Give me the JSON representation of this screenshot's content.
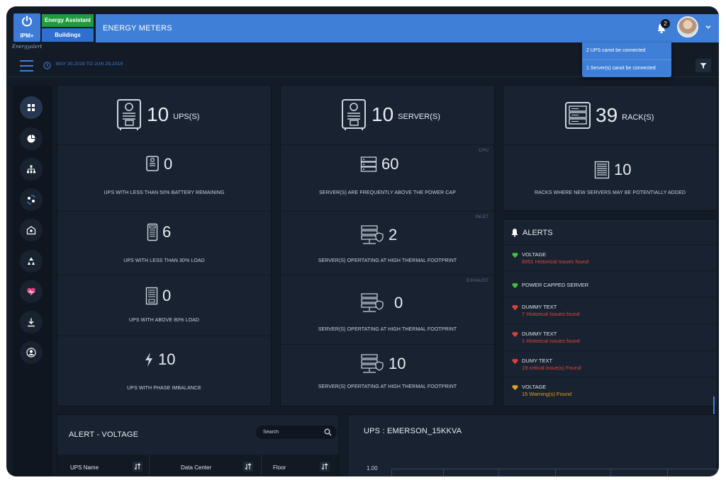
{
  "app": {
    "logo_text": "IPM+",
    "logo_script": "Energyalert",
    "energy_assistant_label": "Energy Assistant",
    "buildings_label": "Buildings",
    "section_title": "ENERGY METERS",
    "notification_count": "2",
    "accent_color": "#3f7fd8"
  },
  "notifications": [
    "2 UPS canot be connected",
    "1 Server(s) canot be connected"
  ],
  "subbar": {
    "date_range": "MAY 30,2019 TO JUN 29,2019"
  },
  "sidebar": {
    "items": [
      {
        "icon": "dashboard-icon",
        "active": true
      },
      {
        "icon": "pie-chart-icon"
      },
      {
        "icon": "hierarchy-icon"
      },
      {
        "icon": "sync-users-icon"
      },
      {
        "icon": "reports-icon"
      },
      {
        "icon": "recycle-icon"
      },
      {
        "icon": "health-icon"
      },
      {
        "icon": "download-icon"
      },
      {
        "icon": "user-icon"
      }
    ]
  },
  "ups_panel": {
    "header": {
      "count": "10",
      "unit": "UPS(S)",
      "icon": "ups-icon"
    },
    "rows": [
      {
        "value": "0",
        "caption": "UPS WITH LESS THAN 50% BATTERY REMAINING",
        "icon": "battery-ups-icon"
      },
      {
        "value": "6",
        "caption": "UPS WITH LESS THAN 30% LOAD",
        "icon": "ups-unit-icon"
      },
      {
        "value": "0",
        "caption": "UPS WITH ABOVE 80% LOAD",
        "icon": "ups-tower-icon"
      },
      {
        "value": "10",
        "caption": "UPS WITH PHASE IMBALANCE",
        "icon": "bolt-icon"
      }
    ]
  },
  "server_panel": {
    "header": {
      "count": "10",
      "unit": "SERVER(S)",
      "icon": "server-ups-icon"
    },
    "rows": [
      {
        "tag": "CPU",
        "value": "60",
        "caption": "SERVER(S) ARE FREQUENTLY ABOVE THE POWER CAP",
        "icon": "server-rack-icon"
      },
      {
        "tag": "INLET",
        "value": "2",
        "caption": "SERVER(S) OPERTATING AT HIGH  THERMAL FOOTPRINT",
        "icon": "server-shield-icon"
      },
      {
        "tag": "EXHAUST",
        "value": "0",
        "caption": "SERVER(S) OPERTATING AT HIGH  THERMAL FOOTPRINT",
        "icon": "server-shield-icon"
      },
      {
        "tag": "",
        "value": "10",
        "caption": "SERVER(S) OPERTATING AT HIGH THERMAL FOOTPRINT",
        "icon": "server-shield-icon"
      }
    ]
  },
  "rack_panel": {
    "header": {
      "count": "39",
      "unit": "RACK(S)",
      "icon": "rack-icon"
    },
    "row": {
      "value": "10",
      "caption": "RACKS WHERE NEW SERVERS MAY BE POTENTIALLY ADDED",
      "icon": "rack-cabinet-icon"
    }
  },
  "alerts": {
    "title": "ALERTS",
    "items": [
      {
        "title": "VOLTAGE",
        "sub": "6051 Historical Issues found",
        "level": "ok",
        "color": "#3fbf3f",
        "subcolor": "#e2463f"
      },
      {
        "title": "POWER CAPPED SERVER",
        "sub": "",
        "level": "ok",
        "color": "#3fbf3f",
        "subcolor": "#e2463f"
      },
      {
        "title": "DUMMY TEXT",
        "sub": "7 Historical Issues found",
        "level": "critical",
        "color": "#d9413a",
        "subcolor": "#e2463f"
      },
      {
        "title": "DUMMY TEXT",
        "sub": "1 Historical Issues found",
        "level": "critical",
        "color": "#d9413a",
        "subcolor": "#e2463f"
      },
      {
        "title": "DUMY TEXT",
        "sub": "19 critical issue(s) Found",
        "level": "critical",
        "color": "#d9413a",
        "subcolor": "#e2463f"
      },
      {
        "title": "VOLTAGE",
        "sub": "15 Warning(s) Found",
        "level": "warning",
        "color": "#e0a020",
        "subcolor": "#e0a020"
      }
    ]
  },
  "alert_voltage": {
    "title": "ALERT - VOLTAGE",
    "search_placeholder": "Search",
    "columns": [
      "UPS Name",
      "Data Center",
      "Floor"
    ]
  },
  "ups_chart": {
    "title": "UPS : EMERSON_15KKVA",
    "y_tick": "1.00"
  }
}
